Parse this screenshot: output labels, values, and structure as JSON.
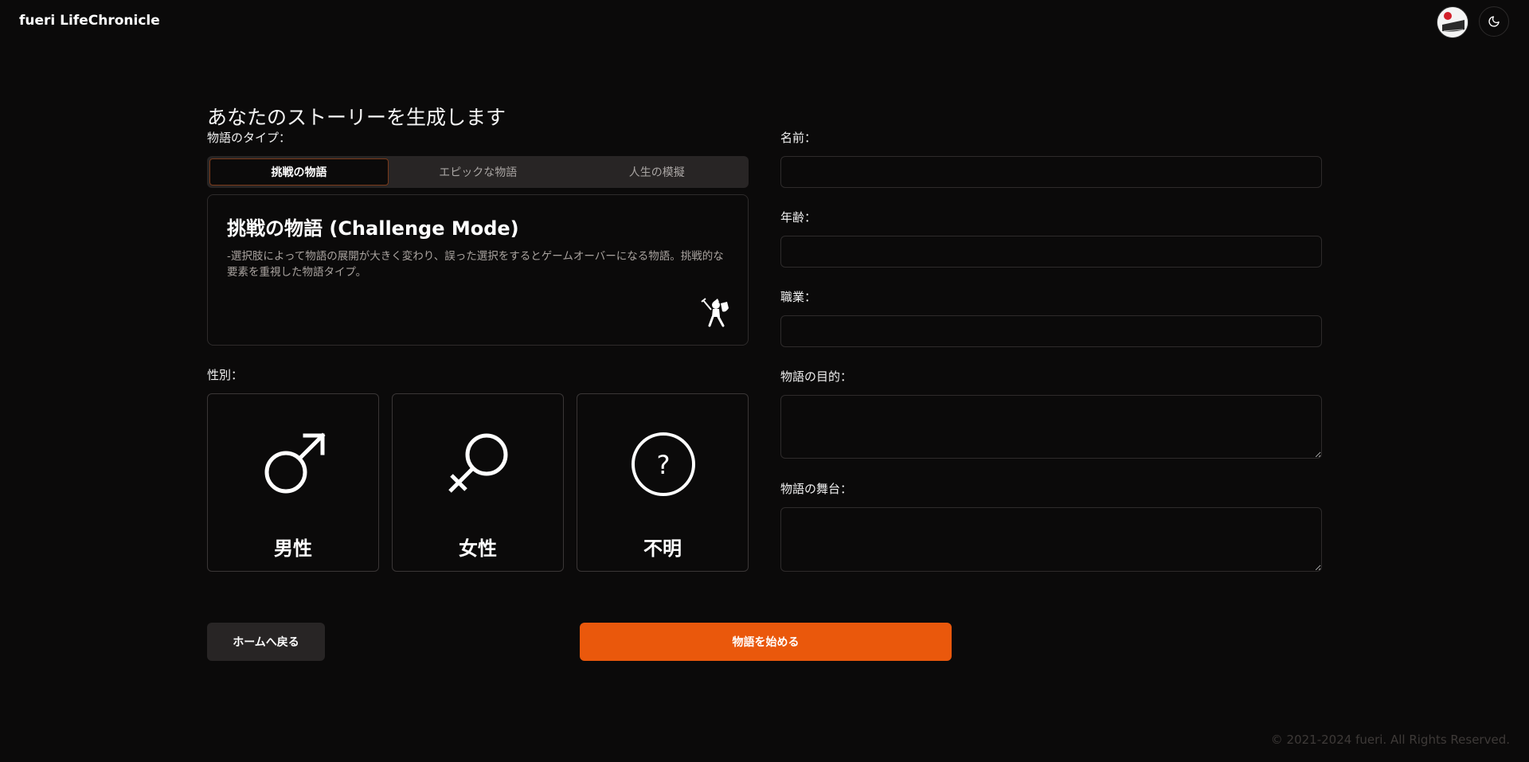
{
  "header": {
    "app_title": "fueri LifeChronicle",
    "avatar_icon": "user-avatar",
    "theme_icon": "moon-icon"
  },
  "main": {
    "heading": "あなたのストーリーを生成します",
    "story_type_label": "物語のタイプ：",
    "tabs": [
      {
        "label": "挑戦の物語",
        "active": true
      },
      {
        "label": "エピックな物語",
        "active": false
      },
      {
        "label": "人生の模擬",
        "active": false
      }
    ],
    "mode_card": {
      "title": "挑戦の物語 (Challenge Mode)",
      "description": "-選択肢によって物語の展開が大きく変わり、誤った選択をするとゲームオーバーになる物語。挑戦的な要素を重視した物語タイプ。",
      "icon": "knight-icon"
    },
    "gender_label": "性別：",
    "genders": [
      {
        "label": "男性",
        "icon": "male-icon"
      },
      {
        "label": "女性",
        "icon": "female-icon"
      },
      {
        "label": "不明",
        "icon": "question-icon"
      }
    ]
  },
  "form": {
    "name_label": "名前：",
    "name_value": "",
    "age_label": "年齢：",
    "age_value": "",
    "occupation_label": "職業：",
    "occupation_value": "",
    "purpose_label": "物語の目的：",
    "purpose_value": "",
    "setting_label": "物語の舞台：",
    "setting_value": ""
  },
  "actions": {
    "home_label": "ホームへ戻る",
    "start_label": "物語を始める"
  },
  "footer": {
    "copyright": "© 2021-2024 fueri. All Rights Reserved."
  },
  "colors": {
    "background": "#0b0a0a",
    "accent": "#ea580c",
    "card_border": "#2e2b2b"
  }
}
